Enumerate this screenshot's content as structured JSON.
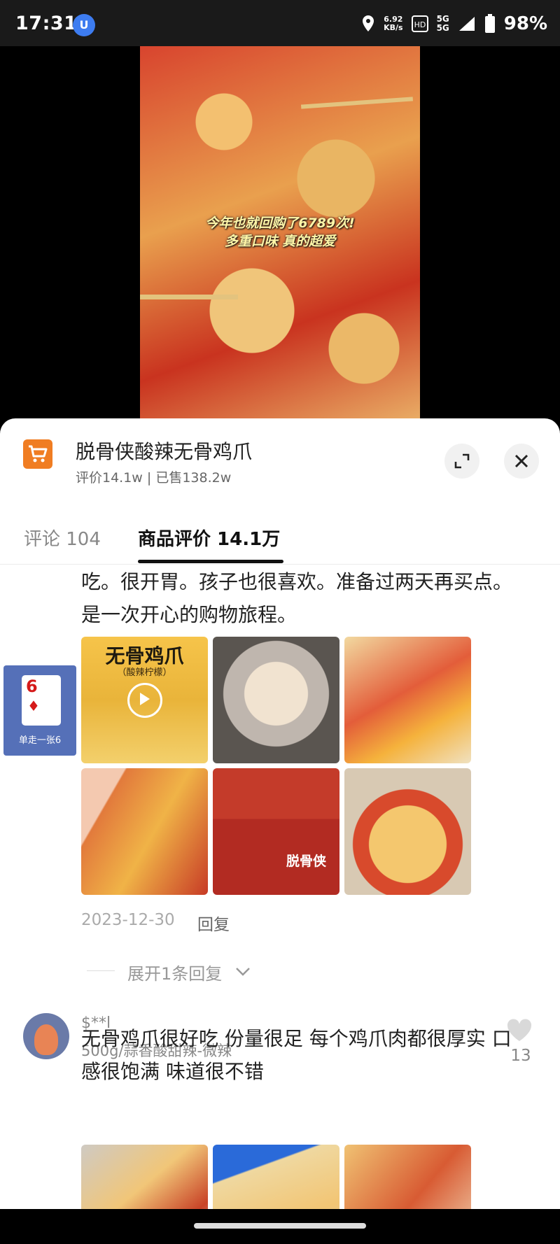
{
  "status_bar": {
    "time": "17:31",
    "app_badge": "U",
    "speed_value": "6.92",
    "speed_unit": "KB/s",
    "network_top": "5G",
    "network_bottom": "5G",
    "battery": "98%"
  },
  "media": {
    "caption_line1": "今年也就回购了6789次!",
    "caption_line2": "多重口味 真的超爱"
  },
  "product": {
    "title": "脱骨侠酸辣无骨鸡爪",
    "meta": "评价14.1w | 已售138.2w"
  },
  "tabs": {
    "comments": "评论 104",
    "reviews": "商品评价 14.1万"
  },
  "review1": {
    "text": "吃。很开胃。孩子也很喜欢。准备过两天再买点。是一次开心的购物旅程。",
    "thumb_label": "无骨鸡爪",
    "thumb_sub": "（酸辣柠檬）",
    "jar_label": "脱骨侠",
    "date": "2023-12-30",
    "reply": "回复",
    "expand": "展开1条回复"
  },
  "review2": {
    "user": "$**l",
    "variant": "500g/蒜香酸甜辣-微辣",
    "likes": "13",
    "text": "无骨鸡爪很好吃 份量很足 每个鸡爪肉都很厚实 口感很饱满 味道很不错"
  },
  "float_card": {
    "rank": "6",
    "suit": "♦",
    "label": "单走一张6"
  },
  "colors": {
    "accent_orange": "#f07d22",
    "card_blue": "#5570b8"
  }
}
